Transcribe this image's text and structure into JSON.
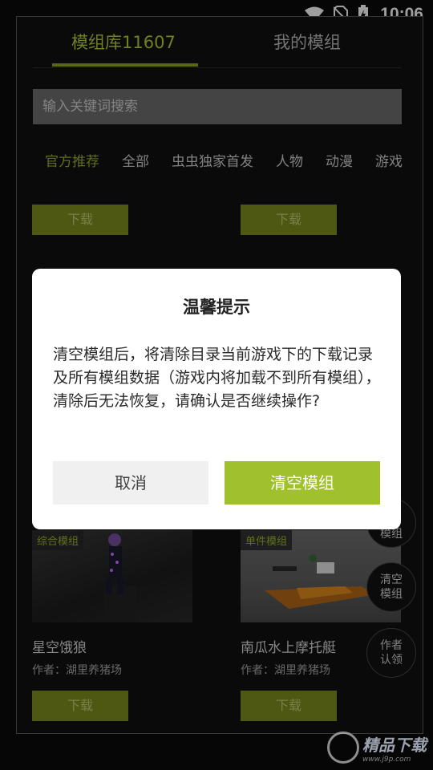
{
  "status_bar": {
    "time": "10:06"
  },
  "tabs": [
    {
      "label": "模组库11607"
    },
    {
      "label": "我的模组"
    }
  ],
  "search": {
    "placeholder": "输入关键词搜索"
  },
  "categories": [
    "官方推荐",
    "全部",
    "虫虫独家首发",
    "人物",
    "动漫",
    "游戏"
  ],
  "download_label": "下载",
  "cards": [
    {
      "tag": "综合模组",
      "title": "星空饿狼",
      "author": "作者：湖里养猪场"
    },
    {
      "tag": "单件模组",
      "title": "南瓜水上摩托艇",
      "author": "作者：湖里养猪场"
    }
  ],
  "fabs": {
    "partial_label": "模组",
    "clear_label": "清空\n模组",
    "author_label": "作者\n认领"
  },
  "dialog": {
    "title": "温馨提示",
    "message": "清空模组后，将清除目录当前游戏下的下载记录及所有模组数据（游戏内将加载不到所有模组），清除后无法恢复，请确认是否继续操作?",
    "cancel_label": "取消",
    "confirm_label": "清空模组"
  },
  "watermark": {
    "text": "精品下载",
    "sub": "www.j9p.com"
  },
  "colors": {
    "accent": "#a0c02e",
    "tab_active": "#b6cd36",
    "download_bg": "#7e8f1f"
  }
}
